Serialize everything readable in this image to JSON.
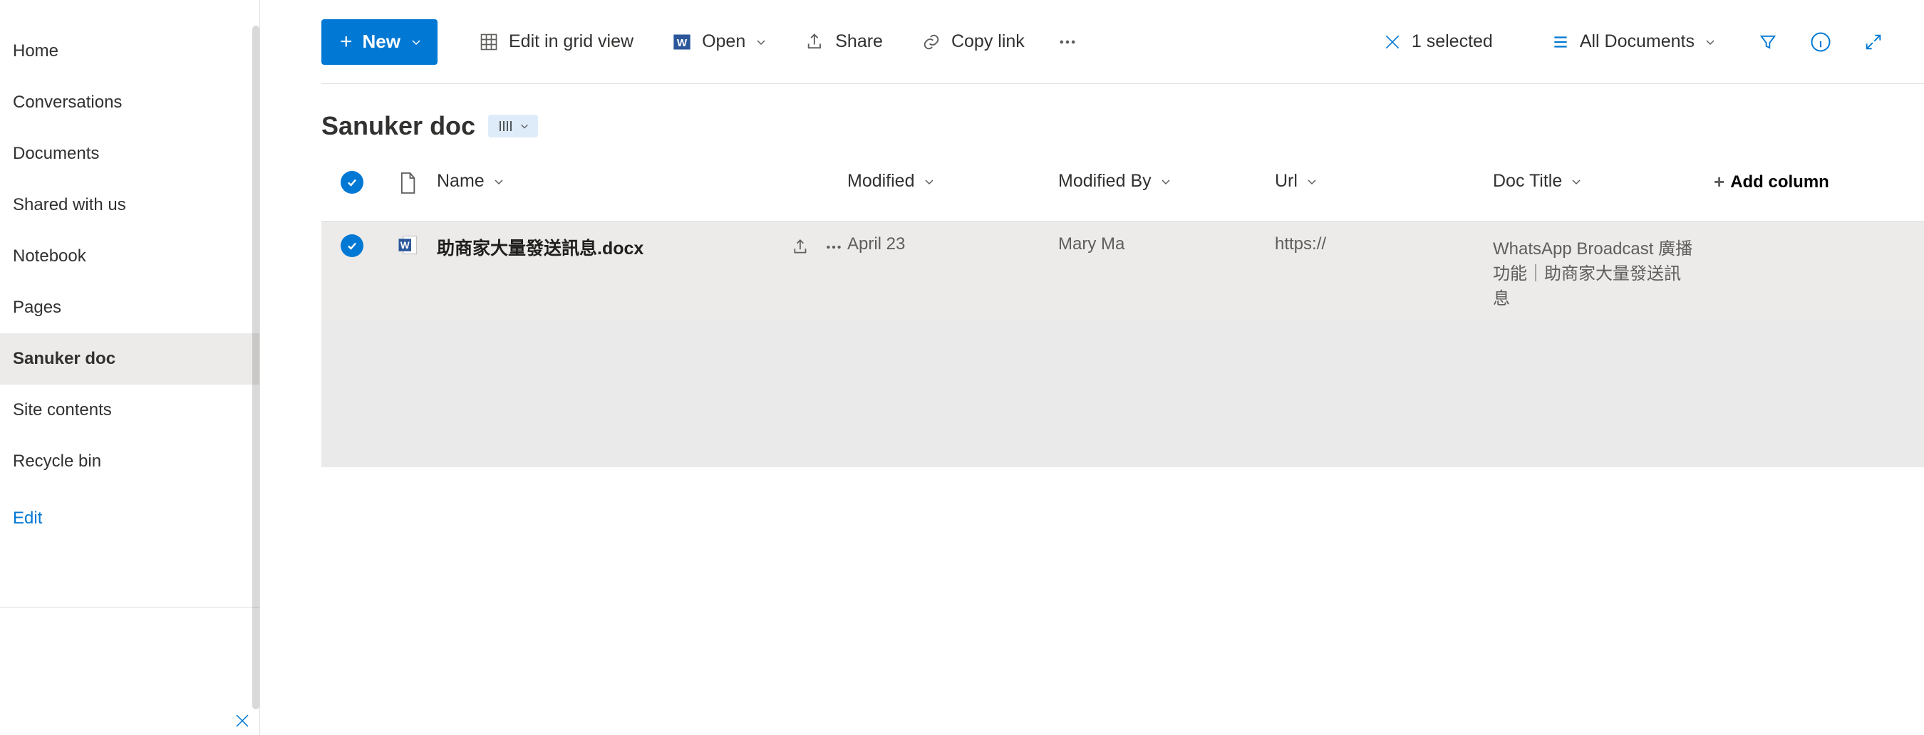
{
  "sidebar": {
    "items": [
      {
        "label": "Home"
      },
      {
        "label": "Conversations"
      },
      {
        "label": "Documents"
      },
      {
        "label": "Shared with us"
      },
      {
        "label": "Notebook"
      },
      {
        "label": "Pages"
      },
      {
        "label": "Sanuker doc"
      },
      {
        "label": "Site contents"
      },
      {
        "label": "Recycle bin"
      }
    ],
    "edit_label": "Edit"
  },
  "toolbar": {
    "new_label": "New",
    "edit_grid_label": "Edit in grid view",
    "open_label": "Open",
    "share_label": "Share",
    "copy_link_label": "Copy link",
    "selected_label": "1 selected",
    "view_label": "All Documents"
  },
  "title": "Sanuker doc",
  "columns": {
    "name": "Name",
    "modified": "Modified",
    "modified_by": "Modified By",
    "url": "Url",
    "doc_title": "Doc Title",
    "add_column": "Add column"
  },
  "rows": [
    {
      "name": "助商家大量發送訊息.docx",
      "modified": "April 23",
      "modified_by": "Mary Ma",
      "url": "https://",
      "doc_title": "WhatsApp Broadcast 廣播功能｜助商家大量發送訊息"
    }
  ]
}
